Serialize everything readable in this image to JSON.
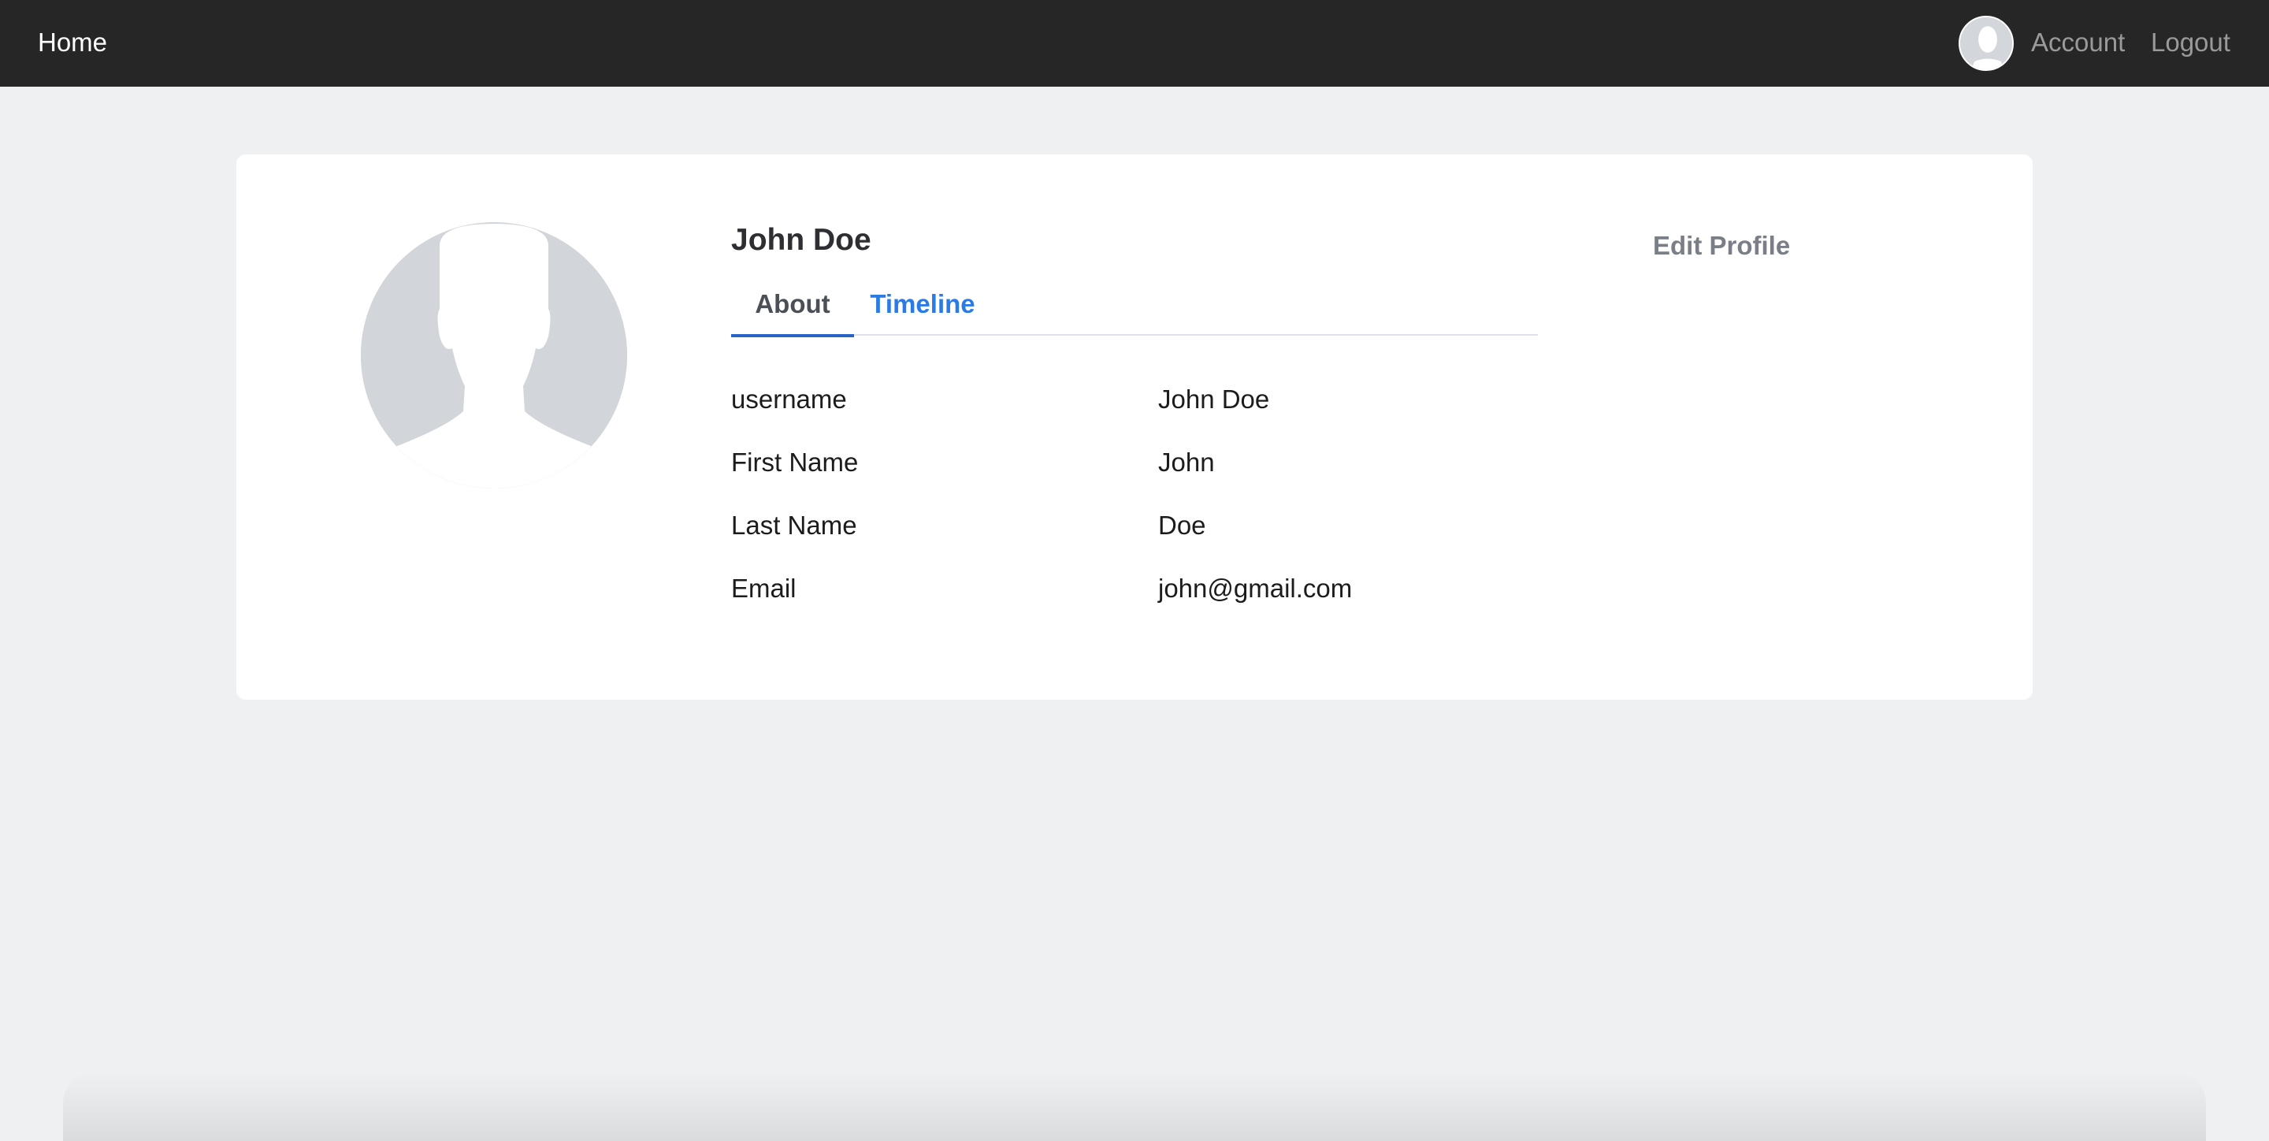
{
  "nav": {
    "home_label": "Home",
    "account_label": "Account",
    "logout_label": "Logout"
  },
  "profile": {
    "name": "John Doe",
    "edit_label": "Edit Profile"
  },
  "tabs": [
    {
      "label": "About",
      "active": true
    },
    {
      "label": "Timeline",
      "active": false
    }
  ],
  "about": {
    "rows": [
      {
        "label": "username",
        "value": "John Doe"
      },
      {
        "label": "First Name",
        "value": "John"
      },
      {
        "label": "Last Name",
        "value": "Doe"
      },
      {
        "label": "Email",
        "value": "john@gmail.com"
      }
    ]
  },
  "colors": {
    "navbar_bg": "#262626",
    "page_bg": "#eff0f2",
    "active_tab_underline": "#2864c8",
    "link_blue": "#2c7be5",
    "avatar_placeholder": "#d2d5da"
  }
}
